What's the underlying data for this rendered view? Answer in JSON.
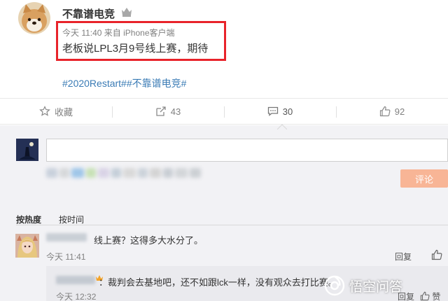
{
  "post": {
    "author": "不靠谱电竞",
    "meta": "今天 11:40 来自 iPhone客户端",
    "text": "老板说LPL3月9号线上赛，期待",
    "tags": "#2020Restart##不靠谱电竞#"
  },
  "actions": [
    {
      "label": "收藏",
      "icon": "star-icon"
    },
    {
      "label": "43",
      "icon": "share-icon"
    },
    {
      "label": "30",
      "icon": "comment-icon"
    },
    {
      "label": "92",
      "icon": "like-icon"
    }
  ],
  "composer": {
    "submit_label": "评论"
  },
  "sort": {
    "hot": "按热度",
    "time": "按时间"
  },
  "comment": {
    "text": "线上赛？这得多大水分了。",
    "time": "今天 11:41",
    "reply_label": "回复"
  },
  "reply": {
    "text": "：裁判会去基地吧，还不如跟lck一样，没有观众去打比赛。",
    "time": "今天 12:32",
    "reply_label": "回复",
    "like_label": "赞"
  },
  "watermark": {
    "text": "悟空问答"
  },
  "colors": {
    "highlight_box": "#e8232a",
    "link": "#3a7bb5",
    "submit_button": "#f8b596",
    "comment_bg": "#f2f2f5"
  }
}
